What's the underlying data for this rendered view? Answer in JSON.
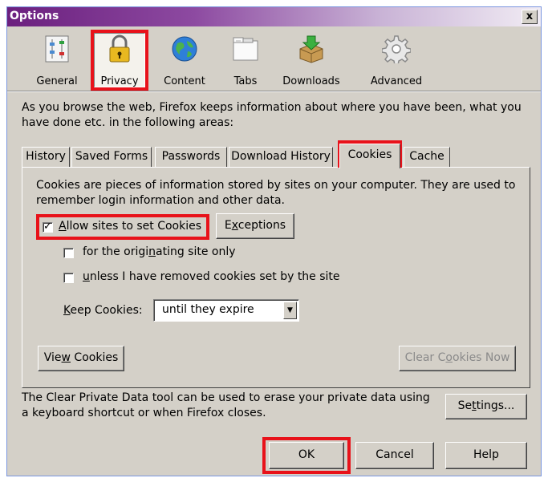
{
  "window": {
    "title": "Options",
    "close_label": "x"
  },
  "categories": [
    {
      "id": "general",
      "label": "General",
      "icon": "general-icon"
    },
    {
      "id": "privacy",
      "label": "Privacy",
      "icon": "lock-icon",
      "selected": true
    },
    {
      "id": "content",
      "label": "Content",
      "icon": "globe-icon"
    },
    {
      "id": "tabs",
      "label": "Tabs",
      "icon": "tabs-icon"
    },
    {
      "id": "downloads",
      "label": "Downloads",
      "icon": "download-box-icon"
    },
    {
      "id": "advanced",
      "label": "Advanced",
      "icon": "gear-icon"
    }
  ],
  "intro": "As you browse the web, Firefox keeps information about where you have been, what you have done etc. in the following areas:",
  "tabs": [
    {
      "label": "History"
    },
    {
      "label": "Saved Forms"
    },
    {
      "label": "Passwords"
    },
    {
      "label": "Download History"
    },
    {
      "label": "Cookies",
      "active": true
    },
    {
      "label": "Cache"
    }
  ],
  "cookies": {
    "description": "Cookies are pieces of information stored by sites on your computer. They are used to remember login information and other data.",
    "allow": {
      "label_pre": "",
      "label_u": "A",
      "label_post": "llow sites to set Cookies",
      "checked": true
    },
    "exceptions_pre": "E",
    "exceptions_u": "x",
    "exceptions_post": "ceptions",
    "originating": {
      "pre": "for the origi",
      "u": "n",
      "post": "ating site only",
      "checked": false
    },
    "unless": {
      "pre": "",
      "u": "u",
      "post": "nless I have removed cookies set by the site",
      "checked": false
    },
    "keep_label_pre": "",
    "keep_label_u": "K",
    "keep_label_post": "eep Cookies:",
    "keep_value": "until they expire",
    "view_pre": "Vie",
    "view_u": "w",
    "view_post": " Cookies",
    "clear_pre": "Clear C",
    "clear_u": "o",
    "clear_post": "okies Now"
  },
  "private_data": {
    "text": "The Clear Private Data tool can be used to erase your private data using a keyboard shortcut or when Firefox closes.",
    "settings_pre": "Se",
    "settings_u": "t",
    "settings_post": "tings..."
  },
  "buttons": {
    "ok": "OK",
    "cancel": "Cancel",
    "help": "Help"
  },
  "colors": {
    "highlight": "#e8121a",
    "dialog_bg": "#d4d0c8",
    "title_start": "#6b1f7e"
  }
}
